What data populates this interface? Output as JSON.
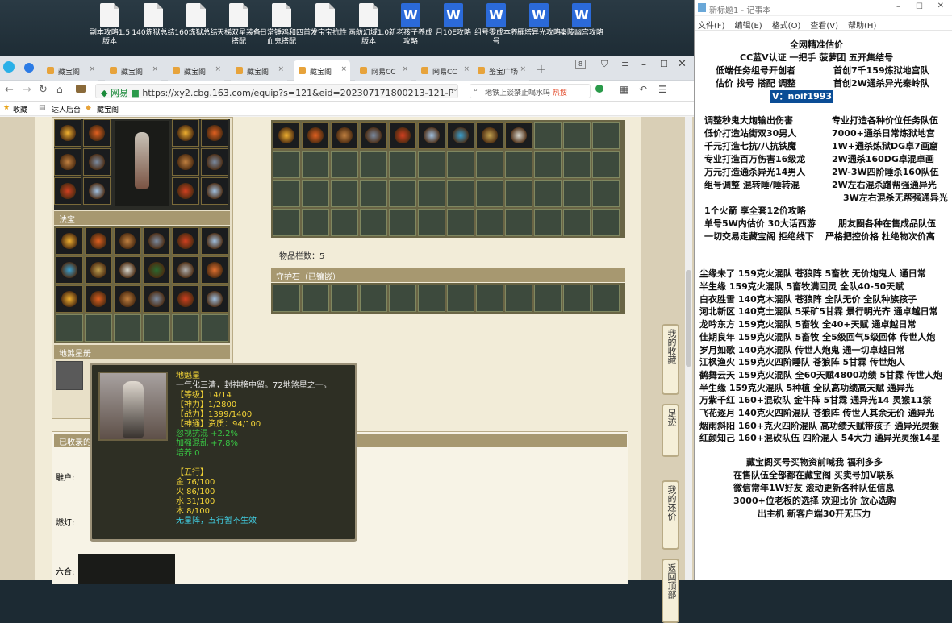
{
  "desktop": {
    "icons": [
      {
        "label": "副本攻略1.5版本",
        "type": "doc"
      },
      {
        "label": "140炼狱总结",
        "type": "doc"
      },
      {
        "label": "160炼狱总结",
        "type": "doc"
      },
      {
        "label": "天梯双星装备搭配",
        "type": "doc"
      },
      {
        "label": "日常锤鸡和四血鬼搭配",
        "type": "doc"
      },
      {
        "label": "首发宝宝抗性",
        "type": "doc"
      },
      {
        "label": "画舫幻域1.0版本",
        "type": "doc"
      },
      {
        "label": "新老孩子养成攻略",
        "type": "word"
      },
      {
        "label": "月10E攻略",
        "type": "word"
      },
      {
        "label": "组号零成本养号",
        "type": "word"
      },
      {
        "label": "雁塔异光攻略",
        "type": "word"
      },
      {
        "label": "秦陵幽宫攻略",
        "type": "word"
      }
    ]
  },
  "browser": {
    "tabs": [
      {
        "label": "藏宝阁"
      },
      {
        "label": "藏宝阁"
      },
      {
        "label": "藏宝阁"
      },
      {
        "label": "藏宝阁"
      },
      {
        "label": "藏宝阁"
      },
      {
        "label": "网易CC"
      },
      {
        "label": "网易CC"
      },
      {
        "label": "鉴宝广场"
      }
    ],
    "active_tab": 4,
    "tab_count": "8",
    "address": {
      "prefix": "网易",
      "url": "https://xy2.cbg.163.com/equip?s=121&eid=202307171800213-121-P"
    },
    "search": {
      "placeholder": "地铁上谈禁止喝水吗",
      "hot": "热搜"
    },
    "bookmarks": [
      {
        "label": "收藏"
      },
      {
        "label": "达人后台"
      },
      {
        "label": "藏宝阁"
      }
    ]
  },
  "game": {
    "sections": {
      "fabao": "法宝",
      "dishalu": "地煞星册",
      "stones": "守护石（已镶嵌）",
      "received": "已收录的"
    },
    "item_count": "物品栏数：5",
    "side_buttons": [
      "我的收藏",
      "足迹",
      "我的还价",
      "返回顶部"
    ],
    "left_labels": [
      "雕户:",
      "燃灯:",
      "六合:"
    ],
    "tooltip": {
      "name": "地魁星",
      "desc": "一气化三清，封神榜中留。72地煞星之一。",
      "stats": [
        {
          "label": "【等级】",
          "value": "14/14"
        },
        {
          "label": "【神力】",
          "value": "1/2800"
        },
        {
          "label": "【战力】",
          "value": "1399/1400"
        },
        {
          "label": "【神通】",
          "value": "资质：94/100"
        }
      ],
      "bonus": [
        {
          "text": "忽视抗混 +2.2%"
        },
        {
          "text": "加强混乱 +7.8%"
        },
        {
          "text": "培养 0"
        }
      ],
      "wuxing_title": "【五行】",
      "wuxing": [
        {
          "text": "金 76/100"
        },
        {
          "text": "火 86/100"
        },
        {
          "text": "水 31/100"
        },
        {
          "text": "木 8/100"
        }
      ],
      "wuxing_note": "无星阵，五行暂不生效"
    }
  },
  "notepad": {
    "title": "新标题1 - 记事本",
    "menu": [
      "文件(F)",
      "编辑(E)",
      "格式(O)",
      "查看(V)",
      "帮助(H)"
    ],
    "lines": [
      "全网精准估价",
      "CC蓝V认证 一把手 菠萝团 五开集结号",
      "低端任务组号开创者",
      "首创7千159炼狱地宫队",
      "估价 找号 搭配 调整",
      "首创2W通杀异光秦岭队",
      "V：noif1993",
      "调整秒鬼大炮输出伤害",
      "专业打造各种价位任务队伍",
      "低价打造站街双30男人",
      "7000+通杀日常炼狱地宫",
      "千元打造七抗/八抗铁魔",
      "1W+通杀炼狱DG卓7画窟",
      "专业打造百万伤害16级龙",
      "2W通杀160DG卓混卓画",
      "万元打造通杀异光14男人",
      "2W-3W四阶睡杀160队伍",
      "组号调整 混转睡/睡转混",
      "2W左右混杀蹭帮强通异光",
      "3W左右混杀无帮强通异光",
      "1个火箭 享全套12价攻略",
      "单号5W内估价 30大话西游",
      "朋友圈各种在售成品队伍",
      "一切交易走藏宝阁 拒绝线下",
      "严格把控价格 杜绝物次价高",
      "尘缘未了 159克火混队 苍狼阵 5畜牧 无价炮鬼人 通日常",
      "半生缘   159克火混队 5畜牧满回灵 全队40-50天赋",
      "白衣胜雪 140克木混队 苍狼阵 全队无价 全队种族孩子",
      "河北新区 140克土混队 5采矿5甘霖 景行明光齐 通卓越日常",
      "龙吟东方 159克火混队 5畜牧 全40+天赋 通卓越日常",
      "佳期良年 159克火混队 5畜牧 全5级回气5级回体 传世人炮",
      "岁月如歌 140克水混队 传世人炮鬼 通一切卓越日常",
      "江枫渔火 159克火四阶睡队 苍狼阵 5甘霖 传世炮人",
      "鹤舞云天 159克火混队 全60天赋4800功绩 5甘霖 传世人炮",
      "半生缘   159克火混队 5种植 全队高功绩高天赋 通异光",
      "万紫千红 160+混砍队 金牛阵 5甘霖 通异光14 灵猴11禁",
      "飞花逐月 140克火四阶混队 苍狼阵 传世人其余无价 通异光",
      "烟雨斜阳 160+克火四阶混队 高功绩天赋带孩子 通异光灵猴",
      "红颜知己 160+混砍队伍 四阶混人 54大力 通异光灵猴14星",
      "藏宝阁买号买物资前喊我 福利多多",
      "在售队伍全部都在藏宝阁 买卖号加V联系",
      "微信常年1W好友 滚动更新各种队伍信息",
      "3000+位老板的选择 欢迎比价 放心选购",
      "出主机 新客户端30开无压力"
    ]
  }
}
